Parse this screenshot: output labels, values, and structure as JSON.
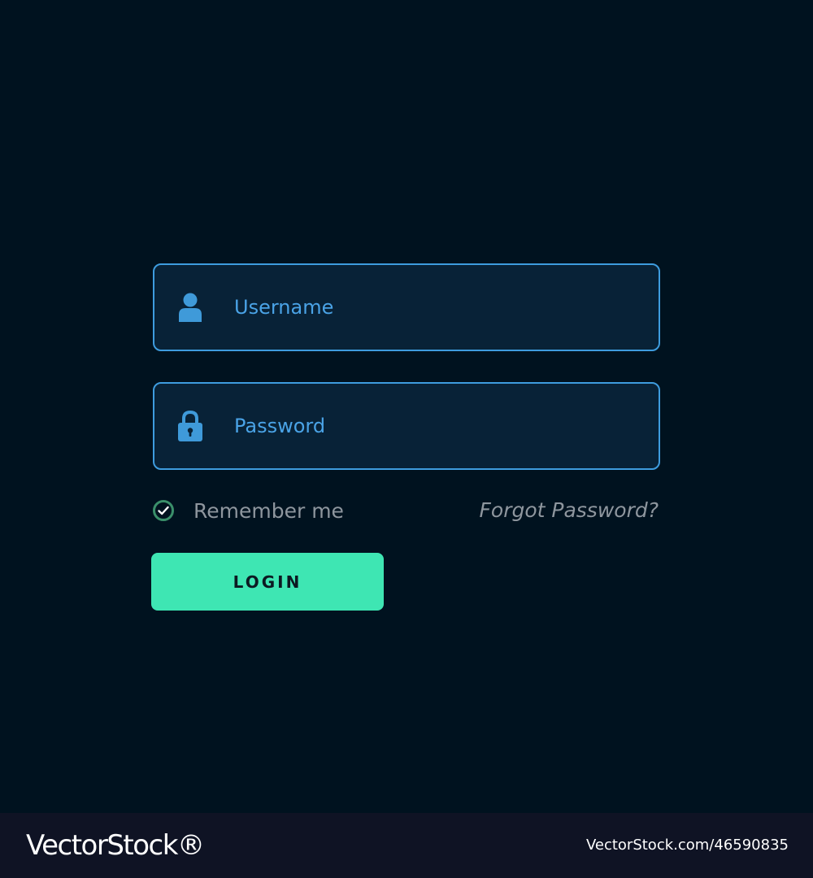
{
  "form": {
    "username": {
      "placeholder": "Username",
      "value": "",
      "icon": "user-icon"
    },
    "password": {
      "placeholder": "Password",
      "value": "",
      "icon": "lock-icon"
    },
    "remember_me": {
      "label": "Remember me",
      "checked": true
    },
    "forgot_password": "Forgot Password?",
    "login_button": "LOGIN"
  },
  "watermark": {
    "logo": "VectorStock®",
    "id": "VectorStock.com/46590835"
  },
  "colors": {
    "background": "#00121f",
    "field_background": "#082237",
    "field_border": "#3e9cde",
    "field_text": "#4aa3e6",
    "accent_button": "#3ee6b3",
    "check_ring": "#3a8f6a",
    "muted_text": "#8e969e"
  }
}
